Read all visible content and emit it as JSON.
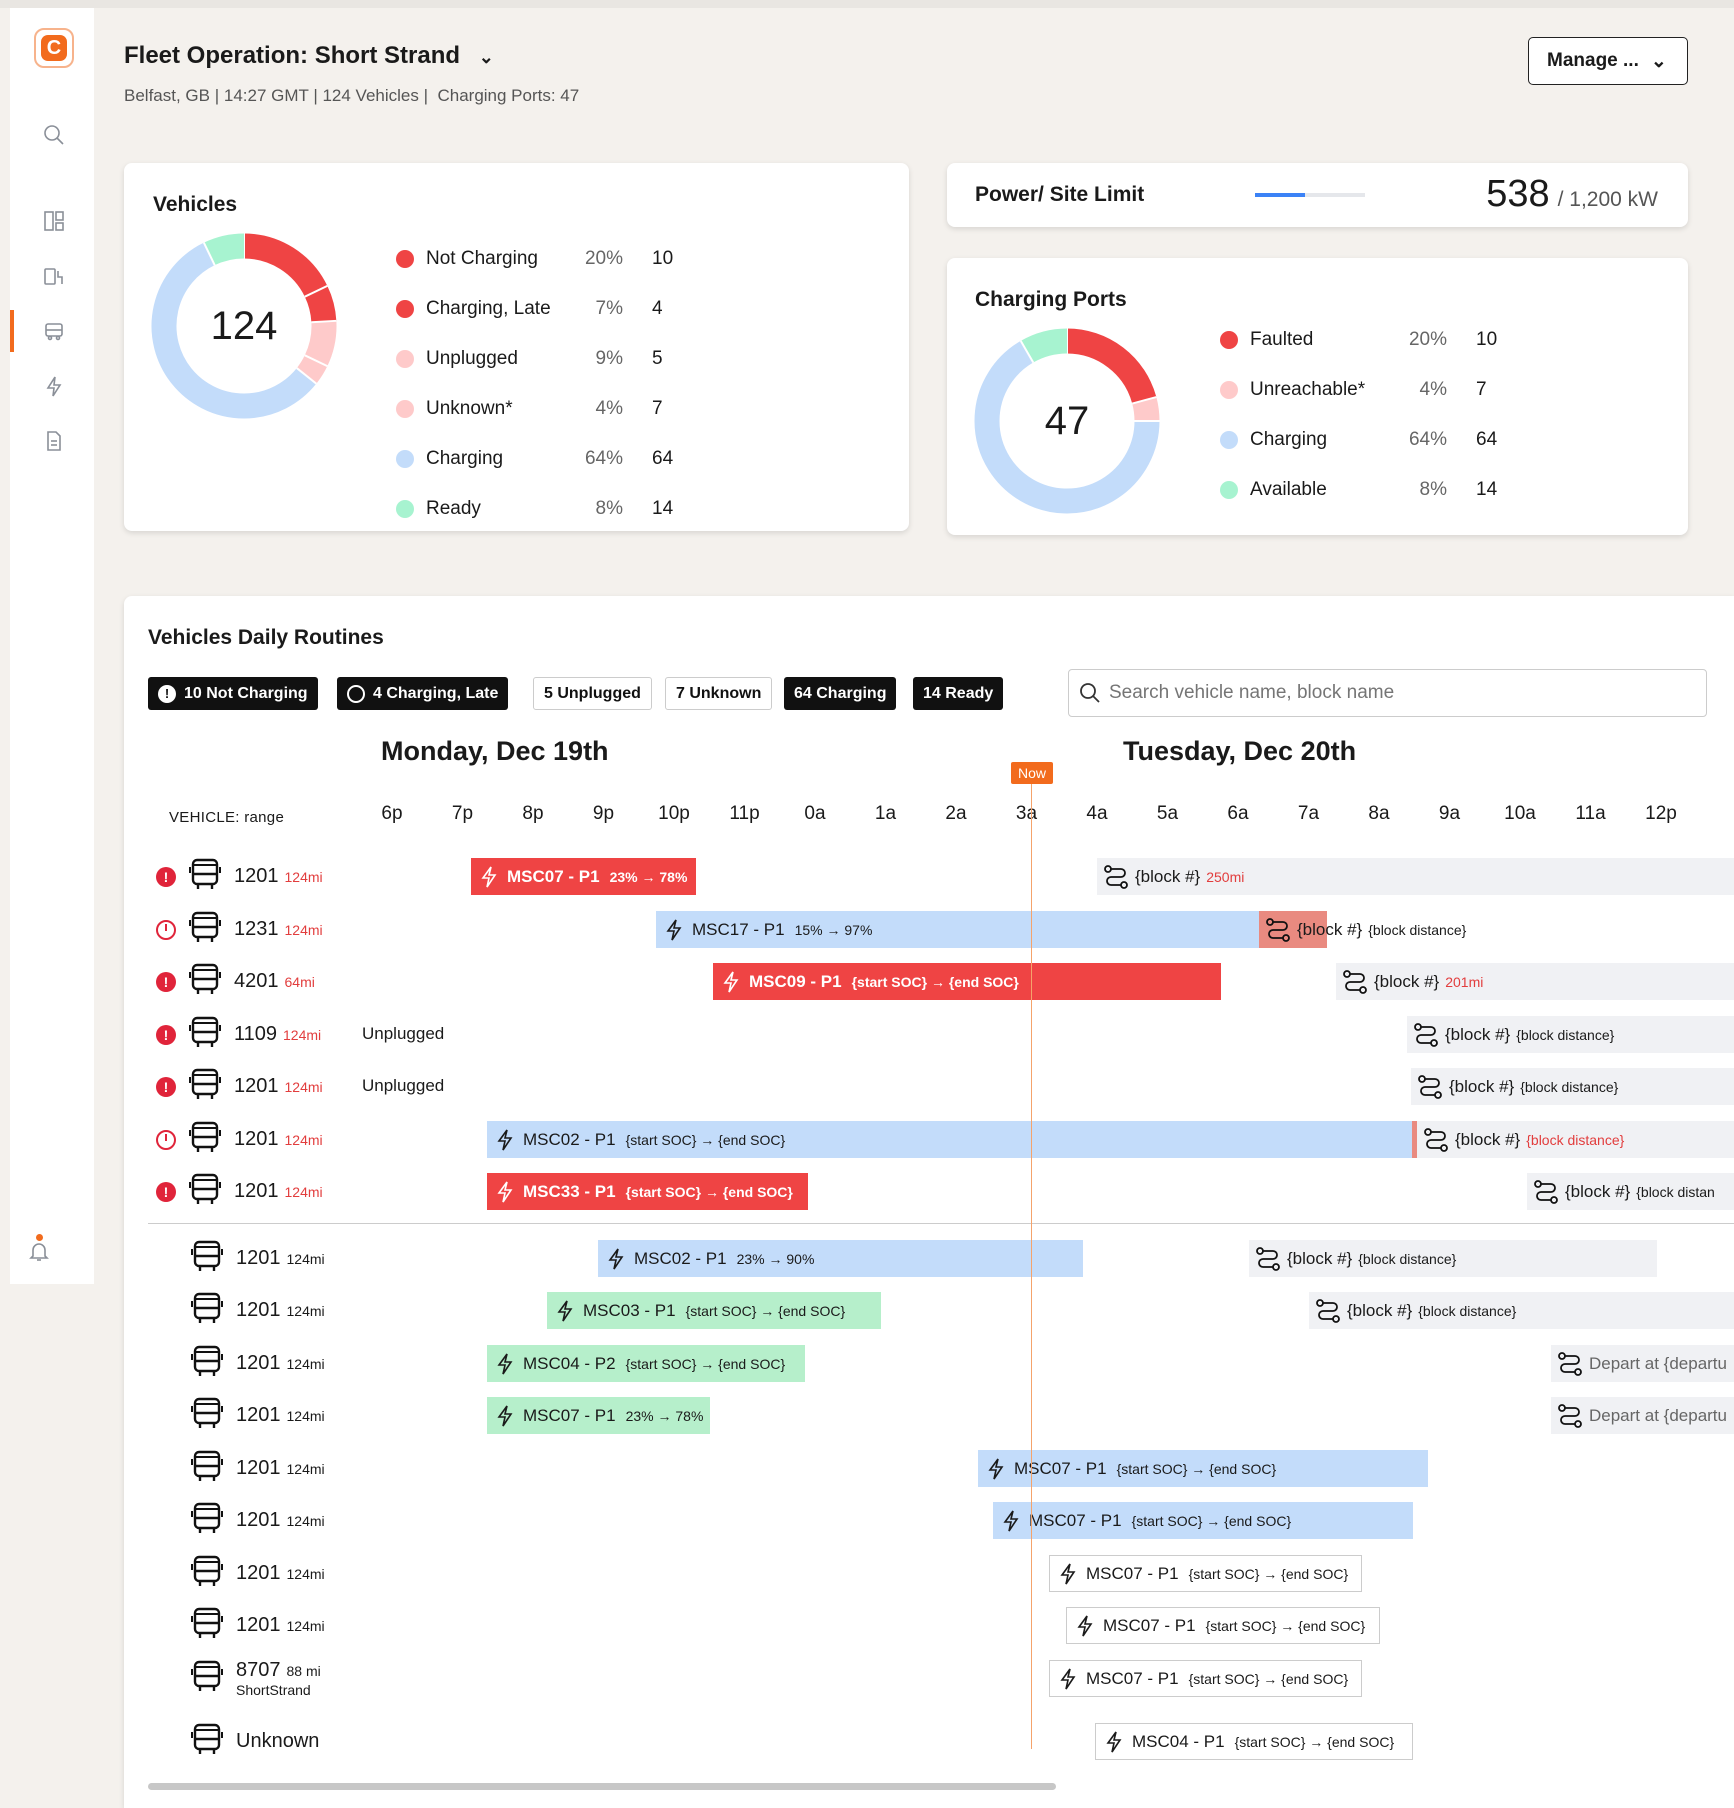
{
  "header": {
    "title": "Fleet Operation: Short Strand",
    "location": "Belfast, GB",
    "time": "14:27 GMT",
    "vehicles": "124 Vehicles",
    "ports": "Charging Ports: 47",
    "manage": "Manage ..."
  },
  "vehicles_card": {
    "title": "Vehicles",
    "total": "124",
    "legend": [
      {
        "label": "Not Charging",
        "pct": "20%",
        "count": "10",
        "color": "#ef4444"
      },
      {
        "label": "Charging, Late",
        "pct": "7%",
        "count": "4",
        "color": "#ef4444"
      },
      {
        "label": "Unplugged",
        "pct": "9%",
        "count": "5",
        "color": "#fecaca"
      },
      {
        "label": "Unknown*",
        "pct": "4%",
        "count": "7",
        "color": "#fecaca"
      },
      {
        "label": "Charging",
        "pct": "64%",
        "count": "64",
        "color": "#c3dcfa"
      },
      {
        "label": "Ready",
        "pct": "8%",
        "count": "14",
        "color": "#a7f3d0"
      }
    ]
  },
  "power_card": {
    "title": "Power/ Site Limit",
    "value": "538",
    "limit": "/ 1,200 kW",
    "fraction": 0.45
  },
  "ports_card": {
    "title": "Charging Ports",
    "total": "47",
    "legend": [
      {
        "label": "Faulted",
        "pct": "20%",
        "count": "10",
        "color": "#ef4444"
      },
      {
        "label": "Unreachable*",
        "pct": "4%",
        "count": "7",
        "color": "#fecaca"
      },
      {
        "label": "Charging",
        "pct": "64%",
        "count": "64",
        "color": "#c3dcfa"
      },
      {
        "label": "Available",
        "pct": "8%",
        "count": "14",
        "color": "#a7f3d0"
      }
    ]
  },
  "routines": {
    "title": "Vehicles Daily Routines",
    "filters": [
      "10 Not Charging",
      "4 Charging, Late",
      "5 Unplugged",
      "7 Unknown",
      "64 Charging",
      "14 Ready"
    ],
    "search_placeholder": "Search vehicle name, block name",
    "day1": "Monday, Dec 19th",
    "day2": "Tuesday, Dec 20th",
    "now": "Now",
    "vehicle_col": "VEHICLE: range",
    "hours": [
      "6p",
      "7p",
      "8p",
      "9p",
      "10p",
      "11p",
      "0a",
      "1a",
      "2a",
      "3a",
      "4a",
      "5a",
      "6a",
      "7a",
      "8a",
      "9a",
      "10a",
      "11a",
      "12p"
    ],
    "unplugged": "Unplugged",
    "rows": [
      {
        "status": "alert",
        "name": "1201",
        "range": "124mi"
      },
      {
        "status": "late",
        "name": "1231",
        "range": "124mi"
      },
      {
        "status": "alert",
        "name": "4201",
        "range": "64mi"
      },
      {
        "status": "alert",
        "name": "1109",
        "range": "124mi"
      },
      {
        "status": "alert",
        "name": "1201",
        "range": "124mi"
      },
      {
        "status": "late",
        "name": "1201",
        "range": "124mi"
      },
      {
        "status": "alert",
        "name": "1201",
        "range": "124mi"
      },
      {
        "status": "",
        "name": "1201",
        "range": "124mi"
      },
      {
        "status": "",
        "name": "1201",
        "range": "124mi"
      },
      {
        "status": "",
        "name": "1201",
        "range": "124mi"
      },
      {
        "status": "",
        "name": "1201",
        "range": "124mi"
      },
      {
        "status": "",
        "name": "1201",
        "range": "124mi"
      },
      {
        "status": "",
        "name": "1201",
        "range": "124mi"
      },
      {
        "status": "",
        "name": "1201",
        "range": "124mi"
      },
      {
        "status": "",
        "name": "1201",
        "range": "124mi"
      },
      {
        "status": "",
        "name": "8707",
        "range": "88 mi",
        "sub": "ShortStrand"
      },
      {
        "status": "",
        "name": "Unknown",
        "range": ""
      }
    ],
    "charge_bars": [
      {
        "label": "MSC07 - P1",
        "soc": "23% → 78%"
      },
      {
        "label": "MSC17 - P1",
        "soc": "15% → 97%"
      },
      {
        "label": "MSC09 - P1",
        "soc": "{start SOC} → {end SOC}"
      },
      {
        "label": "MSC02 - P1",
        "soc": "{start SOC} → {end SOC}"
      },
      {
        "label": "MSC33 - P1",
        "soc": "{start SOC} → {end SOC}"
      },
      {
        "label": "MSC02 - P1",
        "soc": "23% → 90%"
      },
      {
        "label": "MSC03 - P1",
        "soc": "{start SOC} → {end SOC}"
      },
      {
        "label": "MSC04 - P2",
        "soc": "{start SOC} → {end SOC}"
      },
      {
        "label": "MSC07 - P1",
        "soc": "23% → 78%"
      },
      {
        "label": "MSC07 - P1",
        "soc": "{start SOC} → {end SOC}"
      },
      {
        "label": "MSC07 - P1",
        "soc": "{start SOC} → {end SOC}"
      },
      {
        "label": "MSC07 - P1",
        "soc": "{start SOC} → {end SOC}"
      },
      {
        "label": "MSC07 - P1",
        "soc": "{start SOC} → {end SOC}"
      },
      {
        "label": "MSC07 - P1",
        "soc": "{start SOC} → {end SOC}"
      },
      {
        "label": "MSC04 - P1",
        "soc": "{start SOC} → {end SOC}"
      }
    ],
    "blocks": [
      {
        "label": "{block #}",
        "dist": "250mi"
      },
      {
        "label": "{block #}",
        "dist": "{block distance}"
      },
      {
        "label": "{block #}",
        "dist": "201mi"
      },
      {
        "label": "{block #}",
        "dist": "{block distance}"
      },
      {
        "label": "{block #}",
        "dist": "{block distance}"
      },
      {
        "label": "{block #}",
        "dist": "{block distance}"
      },
      {
        "label": "{block #}",
        "dist": "{block distan"
      },
      {
        "label": "{block #}",
        "dist": "{block distance}"
      },
      {
        "label": "{block #}",
        "dist": "{block distance}"
      },
      {
        "label": "Depart at {departu",
        "dist": ""
      },
      {
        "label": "Depart at {departu",
        "dist": ""
      }
    ]
  }
}
